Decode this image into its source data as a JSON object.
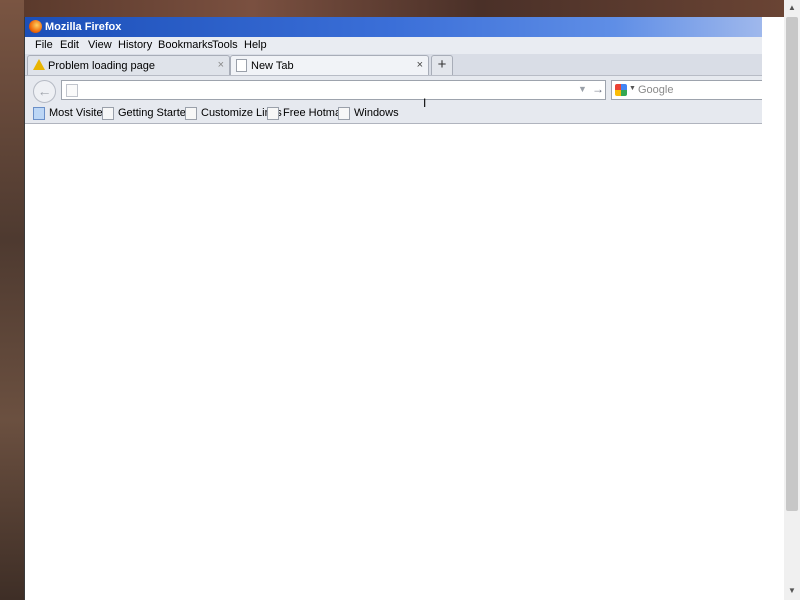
{
  "window": {
    "title": "Mozilla Firefox"
  },
  "menu": [
    {
      "label": "File"
    },
    {
      "label": "Edit"
    },
    {
      "label": "View"
    },
    {
      "label": "History"
    },
    {
      "label": "Bookmarks"
    },
    {
      "label": "Tools"
    },
    {
      "label": "Help"
    }
  ],
  "tabs": [
    {
      "label": "Problem loading page",
      "close": "×",
      "icon": "warning-icon"
    },
    {
      "label": "New Tab",
      "close": "×",
      "icon": "blank-page-icon"
    }
  ],
  "new_tab_label": "+",
  "navbar": {
    "back_glyph": "←",
    "url_value": "",
    "dropdown_glyph": "▼",
    "go_glyph": "→",
    "search_placeholder": "Google",
    "search_engine_icon": "google-icon",
    "search_dropdown_glyph": "▼"
  },
  "bookmarks": [
    {
      "label": "Most Visited"
    },
    {
      "label": "Getting Started"
    },
    {
      "label": "Customize Links"
    },
    {
      "label": "Free Hotmail"
    },
    {
      "label": "Windows"
    }
  ],
  "scrollbar": {
    "up_glyph": "▲",
    "down_glyph": "▼"
  },
  "cursor_glyph": "I",
  "colors": {
    "titlebar_start": "#1c4fb8",
    "titlebar_end": "#9fb8ec",
    "chrome": "#e6e9ef",
    "desktop": "#6b4a3a"
  }
}
